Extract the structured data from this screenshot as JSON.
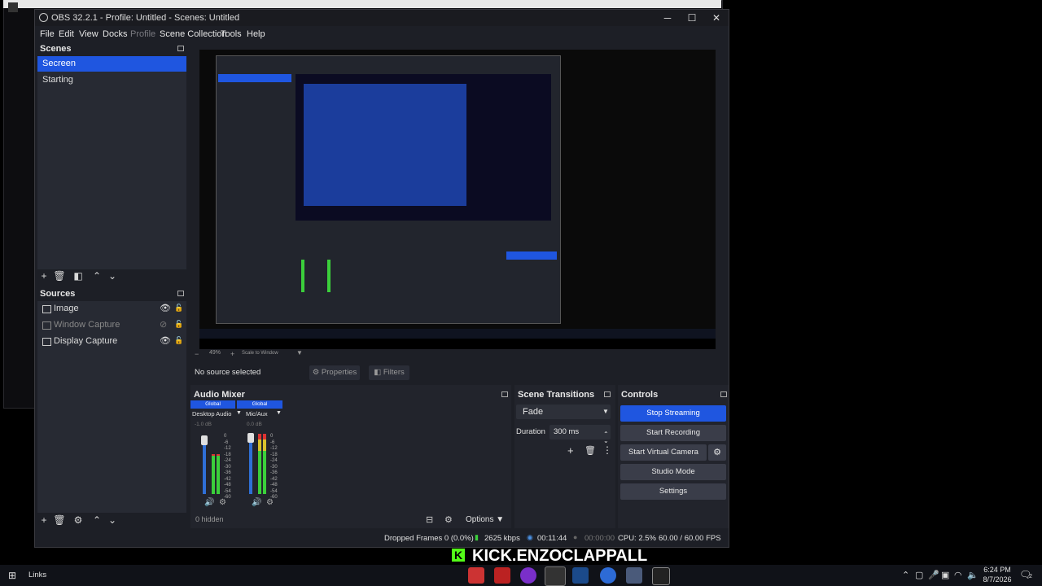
{
  "window": {
    "title": "OBS 32.2.1 - Profile: Untitled - Scenes: Untitled",
    "minimize": "─",
    "maximize": "☐",
    "close": "✕"
  },
  "menu": [
    "File",
    "Edit",
    "View",
    "Docks",
    "Profile",
    "Scene Collection",
    "Tools",
    "Help"
  ],
  "scenes": {
    "title": "Scenes",
    "items": [
      {
        "label": "Secreen",
        "selected": true
      },
      {
        "label": "Starting",
        "selected": false
      }
    ]
  },
  "sources": {
    "title": "Sources",
    "items": [
      {
        "label": "Image",
        "visible": true
      },
      {
        "label": "Window Capture",
        "visible": false
      },
      {
        "label": "Display Capture",
        "visible": true
      }
    ]
  },
  "preview_toolbar": {
    "zoom": "49%",
    "scale_mode": "Scale to Window"
  },
  "source_bar": {
    "status": "No source selected",
    "properties": "Properties",
    "filters": "Filters"
  },
  "audio_mixer": {
    "title": "Audio Mixer",
    "channels": [
      {
        "global": "Global",
        "name": "Desktop Audio",
        "db": "-1.0 dB",
        "level": 0.62
      },
      {
        "global": "Global",
        "name": "Mic/Aux",
        "db": "0.0 dB",
        "level": 0.96
      }
    ],
    "scale": [
      "0",
      "-6",
      "-12",
      "-18",
      "-24",
      "-30",
      "-36",
      "-42",
      "-48",
      "-54",
      "-60"
    ],
    "hidden": "0 hidden",
    "options": "Options"
  },
  "transitions": {
    "title": "Scene Transitions",
    "selected": "Fade",
    "duration_label": "Duration",
    "duration_value": "300 ms"
  },
  "controls": {
    "title": "Controls",
    "buttons": [
      "Stop Streaming",
      "Start Recording",
      "Start Virtual Camera",
      "Studio Mode",
      "Settings"
    ]
  },
  "status": {
    "dropped": "Dropped Frames 0 (0.0%)",
    "bitrate": "2625 kbps",
    "stream_time": "00:11:44",
    "rec_time": "00:00:00",
    "cpu": "CPU: 2.5%",
    "fps": "60.00 / 60.00 FPS"
  },
  "overlay": {
    "text": "KICK.ENZOCLAPPALL",
    "k": "K"
  },
  "taskbar": {
    "label": "Links",
    "time": "6:24 PM",
    "date": "8/7/2026",
    "notification_count": "2"
  },
  "colors": {
    "accent": "#1f56e0",
    "kick_green": "#53fc18"
  }
}
